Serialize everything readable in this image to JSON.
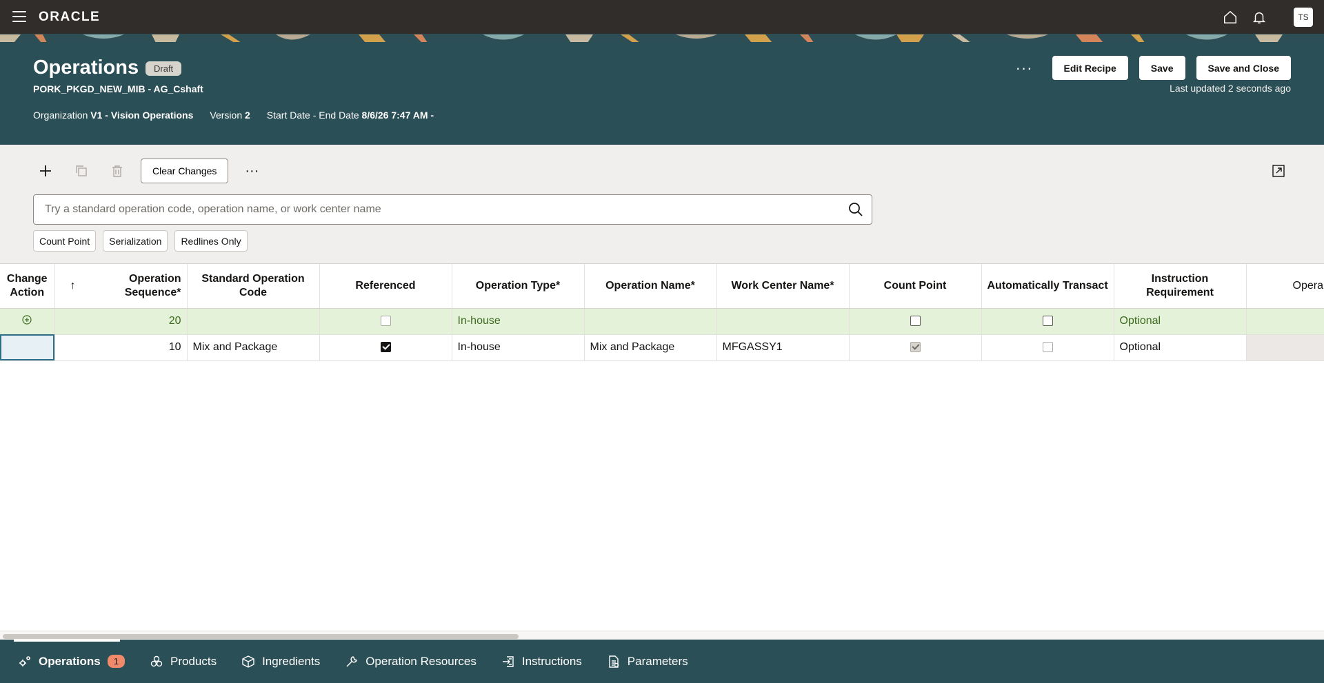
{
  "app": {
    "logo_text": "ORACLE",
    "user_initials": "TS"
  },
  "header": {
    "title": "Operations",
    "status": "Draft",
    "subtitle": "PORK_PKGD_NEW_MIB - AG_Cshaft",
    "organization_label": "Organization",
    "organization_value": "V1 - Vision Operations",
    "version_label": "Version",
    "version_value": "2",
    "dates_label": "Start Date - End Date",
    "dates_value": "8/6/26 7:47 AM -",
    "edit_recipe_label": "Edit Recipe",
    "save_label": "Save",
    "save_close_label": "Save and Close",
    "last_updated": "Last updated 2 seconds ago"
  },
  "toolbar": {
    "clear_changes_label": "Clear Changes"
  },
  "search": {
    "placeholder": "Try a standard operation code, operation name, or work center name",
    "value": ""
  },
  "filters": [
    "Count Point",
    "Serialization",
    "Redlines Only"
  ],
  "table": {
    "headers": {
      "change_action": "Change Action",
      "sort_arrow": "↑",
      "op_seq": "Operation Sequence*",
      "std_op_code": "Standard Operation Code",
      "referenced": "Referenced",
      "op_type": "Operation Type*",
      "op_name": "Operation Name*",
      "work_center": "Work Center Name*",
      "count_point": "Count Point",
      "auto_transact": "Automatically Transact",
      "instruction_req": "Instruction Requirement",
      "operation_more": "Opera"
    },
    "rows": [
      {
        "op_seq": "20",
        "std_op_code": "",
        "referenced": false,
        "op_type": "In-house",
        "op_name": "",
        "work_center": "",
        "count_point": false,
        "auto_transact": false,
        "instruction_req": "Optional"
      },
      {
        "op_seq": "10",
        "std_op_code": "Mix and Package",
        "referenced": true,
        "op_type": "In-house",
        "op_name": "Mix and Package",
        "work_center": "MFGASSY1",
        "count_point": true,
        "auto_transact": false,
        "instruction_req": "Optional"
      }
    ]
  },
  "bottom_tabs": [
    {
      "label": "Operations",
      "icon": "gears-icon",
      "badge": "1",
      "active": true
    },
    {
      "label": "Products",
      "icon": "products-icon"
    },
    {
      "label": "Ingredients",
      "icon": "cube-icon"
    },
    {
      "label": "Operation Resources",
      "icon": "wrench-icon"
    },
    {
      "label": "Instructions",
      "icon": "instructions-icon"
    },
    {
      "label": "Parameters",
      "icon": "parameters-icon"
    }
  ],
  "colors": {
    "header_bg": "#2b4f56",
    "topbar_bg": "#312d2a",
    "added_row_bg": "#e3f2d9",
    "badge_bg": "#f08a6b"
  }
}
